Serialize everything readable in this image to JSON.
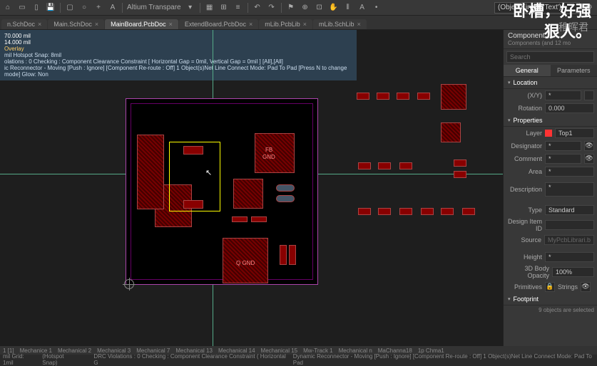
{
  "overlay": {
    "line1": "卧槽，好强",
    "line2": "狠人。",
    "watermark": "稚晖君"
  },
  "toolbar": {
    "title": "Altium Transpare",
    "filter": "(ObjectKind = 'Text')"
  },
  "tabs": [
    {
      "label": "n.SchDoc",
      "active": false
    },
    {
      "label": "Main.SchDoc",
      "active": false
    },
    {
      "label": "MainBoard.PcbDoc",
      "active": true
    },
    {
      "label": "ExtendBoard.PcbDoc",
      "active": false
    },
    {
      "label": "mLib.PcbLib",
      "active": false
    },
    {
      "label": "mLib.SchLib",
      "active": false
    }
  ],
  "info": {
    "coord1": "70.000 mil",
    "coord2": "14.000 mil",
    "overlay": "Overlay",
    "hotspot": "mil Hotspot Snap: 8mil",
    "violations": "olations : 0 Checking : Component Clearance Constraint [ Horizontal Gap = 0mil, Vertical Gap = 0mil ] [All],[All]",
    "reconnector": "ic Reconnector - Moving [Push : Ignore] [Component Re-route : Off] 1 Object(s)Net Line Connect Mode: Pad To Pad [Press N to change mode] Glow: Non"
  },
  "pcb": {
    "labels": {
      "fb": "FB",
      "gnd": "GND",
      "q_gnd": "Q GND"
    }
  },
  "panel": {
    "header_line1": "Component",
    "header_line2": "Components (and 12 mo",
    "search_placeholder": "Search",
    "tabs": {
      "general": "General",
      "parameters": "Parameters"
    },
    "sections": {
      "location": "Location",
      "properties": "Properties",
      "footprint": "Footprint"
    },
    "location": {
      "xy_label": "(X/Y)",
      "xy": "*",
      "rotation_label": "Rotation",
      "rotation": "0.000"
    },
    "properties": {
      "layer_label": "Layer",
      "layer": "Top1",
      "designator_label": "Designator",
      "designator": "*",
      "comment_label": "Comment",
      "comment": "*",
      "area_label": "Area",
      "area": "*",
      "description_label": "Description",
      "description": "*",
      "type_label": "Type",
      "type": "Standard",
      "design_item_label": "Design Item ID",
      "design_item": "",
      "source_label": "Source",
      "source": "MyPcbLibrari.b",
      "height_label": "Height",
      "height": "*",
      "opacity_label": "3D Body Opacity",
      "opacity": "100%",
      "primitives_label": "Primitives",
      "strings_label": "Strings"
    },
    "selected": "9 objects are selected"
  },
  "layer_bar": {
    "items": [
      "1 [1]",
      "Mechanice 1",
      "Mechanical 2",
      "Mechanical 3",
      "Mechanical 7",
      "Mechanical 13",
      "Mechanical 14",
      "Mechanical 15",
      "Mw-Track 1",
      "Mechanical n",
      "MaChanna18",
      "1p Chma1"
    ]
  },
  "status": {
    "grid": "mil   Grid: 1mil",
    "snap": "(Hotspot Snap)",
    "drc": "DRC Violations : 0 Checking : Component Clearance Constraint ( Horizontal G",
    "dynamic": "Dynamic Reconnector - Moving [Push : Ignore] [Component Re-route : Off] 1 Object(s)Net Line Connect Mode: Pad To Pad"
  }
}
